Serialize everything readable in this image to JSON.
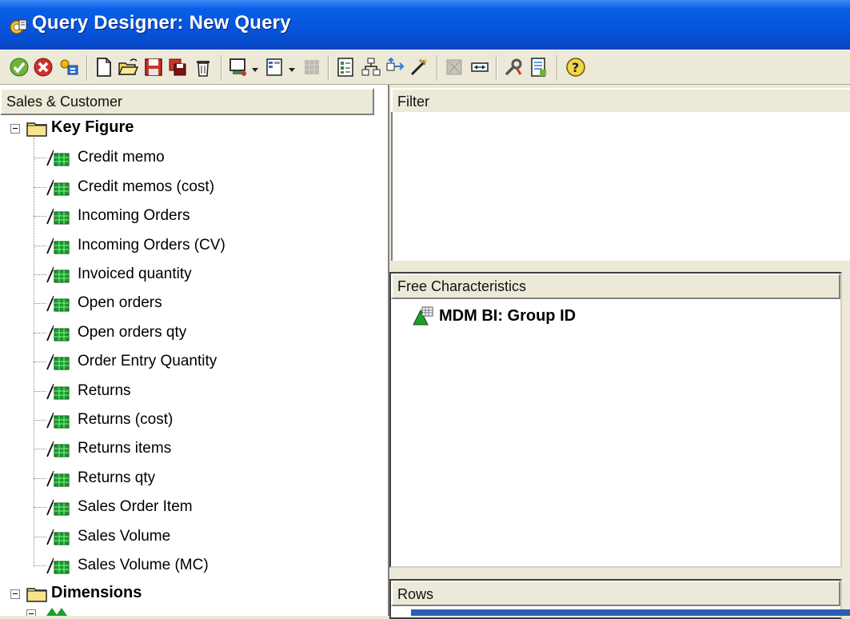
{
  "window": {
    "title": "Query Designer: New Query"
  },
  "toolbar": {
    "buttons": [
      "check-icon",
      "cancel-icon",
      "key-icon",
      "new-icon",
      "open-icon",
      "save-icon",
      "copy-icon",
      "delete-icon",
      "display-icon",
      "columns-icon",
      "grid-icon",
      "properties-icon",
      "network-icon",
      "arrows-icon",
      "magic-icon",
      "selection-icon",
      "link-icon",
      "tools-icon",
      "document-icon",
      "help-icon"
    ]
  },
  "left_panel": {
    "header": "Sales & Customer",
    "key_figure_folder": "Key Figure",
    "key_figures": [
      "Credit memo",
      "Credit memos (cost)",
      "Incoming Orders",
      "Incoming Orders (CV)",
      "Invoiced quantity",
      "Open orders",
      "Open orders qty",
      "Order Entry Quantity",
      "Returns",
      "Returns (cost)",
      "Returns items",
      "Returns qty",
      "Sales Order Item",
      "Sales Volume",
      "Sales Volume (MC)"
    ],
    "dimensions_folder": "Dimensions"
  },
  "filter_panel": {
    "header": "Filter"
  },
  "free_characteristics": {
    "header": "Free Characteristics",
    "items": [
      "MDM BI: Group ID"
    ]
  },
  "rows_panel": {
    "header": "Rows"
  },
  "colors": {
    "titlebar": "#0655de",
    "panel_bg": "#ece9d8",
    "kf_green": "#00a000"
  }
}
